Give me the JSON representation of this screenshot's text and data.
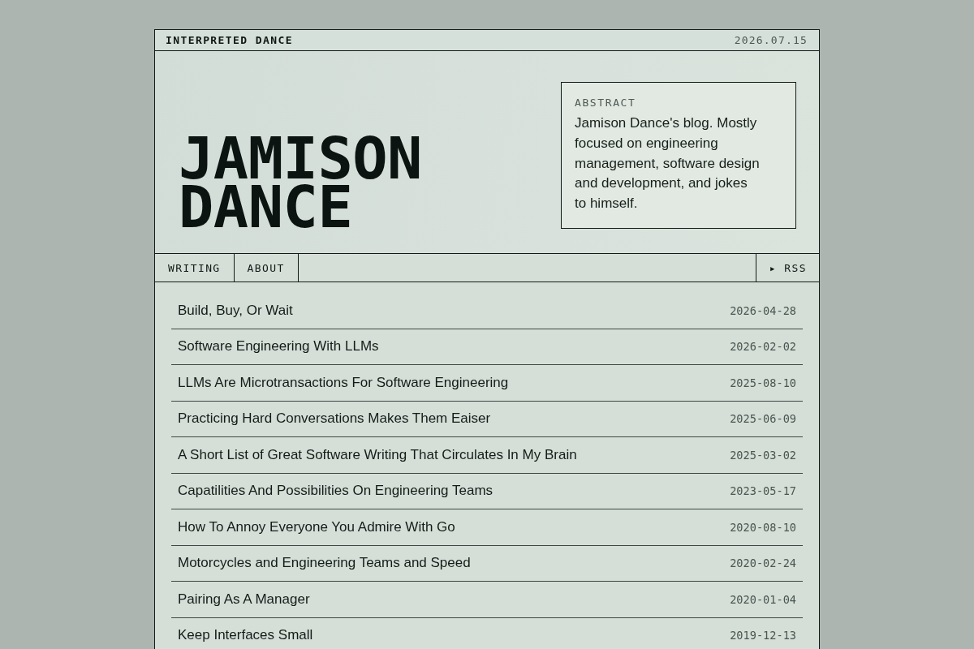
{
  "top_bar": {
    "site_name": "INTERPRETED DANCE",
    "date": "2026.07.15"
  },
  "header": {
    "title": "JAMISON DANCE",
    "abstract": {
      "label": "ABSTRACT",
      "text": "Jamison Dance's blog. Mostly focused on engineering management, software design and development, and jokes to himself."
    }
  },
  "nav": {
    "links": [
      {
        "label": "WRITING"
      },
      {
        "label": "ABOUT"
      }
    ],
    "rss": {
      "label": "▸ RSS"
    }
  },
  "posts": [
    {
      "title": "Build, Buy, Or Wait",
      "date": "2026-04-28"
    },
    {
      "title": "Software Engineering With LLMs",
      "date": "2026-02-02"
    },
    {
      "title": "LLMs Are Microtransactions For Software Engineering",
      "date": "2025-08-10"
    },
    {
      "title": "Practicing Hard Conversations Makes Them Eaiser",
      "date": "2025-06-09"
    },
    {
      "title": "A Short List of Great Software Writing That Circulates In My Brain",
      "date": "2025-03-02"
    },
    {
      "title": "Capatilities And Possibilities On Engineering Teams",
      "date": "2023-05-17"
    },
    {
      "title": "How To Annoy Everyone You Admire With Go",
      "date": "2020-08-10"
    },
    {
      "title": "Motorcycles and Engineering Teams and Speed",
      "date": "2020-02-24"
    },
    {
      "title": "Pairing As A Manager",
      "date": "2020-01-04"
    },
    {
      "title": "Keep Interfaces Small",
      "date": "2019-12-13"
    }
  ]
}
